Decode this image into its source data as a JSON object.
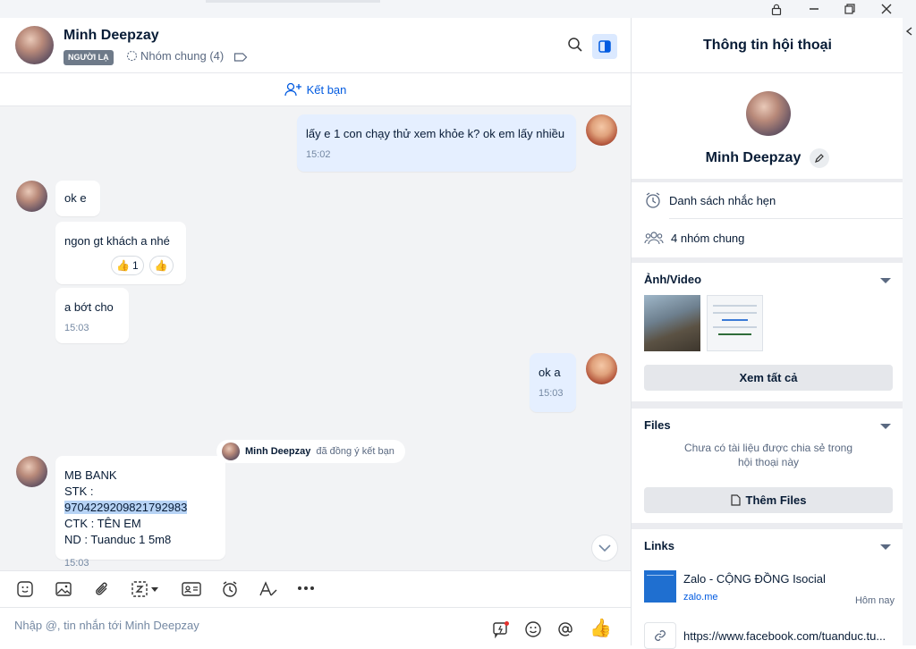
{
  "header": {
    "name": "Minh Deepzay",
    "badge": "NGƯỜI LẠ",
    "groups": "Nhóm chung (4)"
  },
  "friend_bar": {
    "label": "Kết bạn"
  },
  "messages": {
    "m1": {
      "text": "lấy e 1 con chạy thử xem khỏe k? ok em lấy nhiều",
      "time": "15:02"
    },
    "m2": {
      "text": "ok e"
    },
    "m3": {
      "text": "ngon gt khách a nhé",
      "react_count": "1"
    },
    "m4": {
      "text": "a bớt cho",
      "time": "15:03"
    },
    "m5": {
      "text": "ok a",
      "time": "15:03"
    },
    "system": {
      "name": "Minh Deepzay",
      "text": "đã đồng ý kết bạn"
    },
    "m6": {
      "line1": "MB BANK",
      "line2_prefix": "STK : ",
      "line2_highlight": "9704229209821792983",
      "line3": "CTK : TÊN EM",
      "line4": "ND : Tuanduc 1 5m8",
      "time": "15:03"
    }
  },
  "composer": {
    "placeholder": "Nhập @, tin nhắn tới Minh Deepzay"
  },
  "side": {
    "title": "Thông tin hội thoại",
    "name": "Minh Deepzay",
    "reminders": "Danh sách nhắc hẹn",
    "common_groups": "4 nhóm chung",
    "media_title": "Ảnh/Video",
    "view_all": "Xem tất cả",
    "files_title": "Files",
    "files_empty": "Chưa có tài liệu được chia sẻ trong hội thoại này",
    "add_files": "Thêm Files",
    "links_title": "Links",
    "link1_title": "Zalo - CỘNG ĐỒNG Isocial",
    "link1_domain": "zalo.me",
    "link1_time": "Hôm nay",
    "link2_title": "https://www.facebook.com/tuanduc.tu..."
  },
  "colors": {
    "accent": "#005ae0",
    "my_bubble": "#e5efff",
    "chat_bg": "#f2f3f5"
  }
}
